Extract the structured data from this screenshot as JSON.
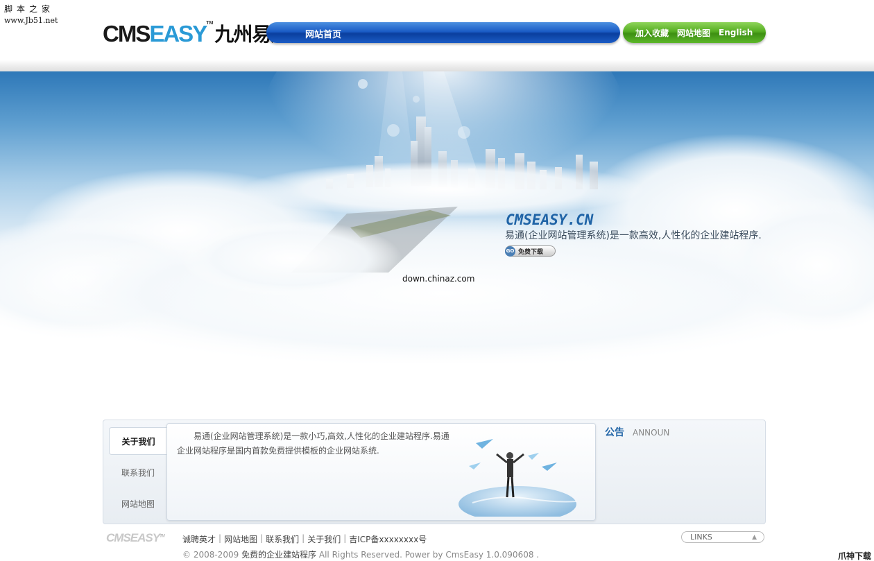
{
  "watermark": {
    "cn": "脚本之家",
    "en": "www.Jb51.net"
  },
  "logo": {
    "cms": "CMS",
    "easy": "EASY",
    "tm": "TM",
    "cn": "九州易通"
  },
  "nav": {
    "home": "网站首页",
    "right": [
      "加入收藏",
      "网站地图",
      "English"
    ]
  },
  "banner": {
    "title": "CMSEASY.CN",
    "desc": "易通(企业网站管理系统)是一款高效,人性化的企业建站程序.",
    "button": "免费下载",
    "button_icon": "GO",
    "caption": "down.chinaz.com"
  },
  "tabs": [
    "关于我们",
    "联系我们",
    "网站地图"
  ],
  "about_text": "易通(企业网站管理系统)是一款小巧,高效,人性化的企业建站程序.易通企业网站程序是国内首款免费提供模板的企业网站系统.",
  "notice": {
    "title": "公告",
    "sub": "ANNOUN"
  },
  "footer": {
    "logo": "CMSEASY",
    "logo_tm": "TM",
    "links": [
      "诚聘英才",
      "网站地图",
      "联系我们",
      "关于我们",
      "吉ICP备xxxxxxxx号"
    ],
    "copy_pre": "© 2008-2009 ",
    "copy_em": "免费的企业建站程序",
    "copy_post": " All Rights Reserved.  Power by CmsEasy 1.0.090608 .",
    "links_select": "LINKS"
  },
  "corner_text": "爪神下载网",
  "colors": {
    "nav_blue": "#1b5cc5",
    "nav_green": "#55ad22",
    "accent": "#1f63a6"
  }
}
